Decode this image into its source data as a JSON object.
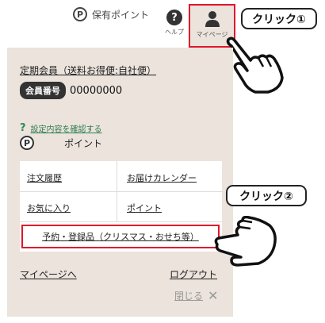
{
  "header": {
    "points_label": "保有ポイント",
    "help_label": "ヘルプ",
    "mypage_label": "マイページ"
  },
  "callouts": {
    "first": "クリック①",
    "second": "クリック②"
  },
  "panel": {
    "member_type": "定期会員（送料お得便:自社便）",
    "member_badge": "会員番号",
    "member_number": "00000000",
    "confirm_link": "設定内容を確認する",
    "points_label": "ポイント",
    "menu": {
      "order_history": "注文履歴",
      "delivery_calendar": "お届けカレンダー",
      "favorites": "お気に入り",
      "points": "ポイント"
    },
    "reserve_button": "予約・登録品（クリスマス・おせち等）",
    "mypage_link": "マイページへ",
    "logout_link": "ログアウト",
    "close_label": "閉じる"
  },
  "colors": {
    "panel_bg": "#ebe3dc",
    "highlight": "#e0162b",
    "link_green": "#2e7d4f"
  },
  "icons": {
    "points": "points-p-icon",
    "help": "question-mark-icon",
    "mypage": "person-icon",
    "close": "close-x-icon",
    "pointer": "pointing-hand-icon"
  }
}
